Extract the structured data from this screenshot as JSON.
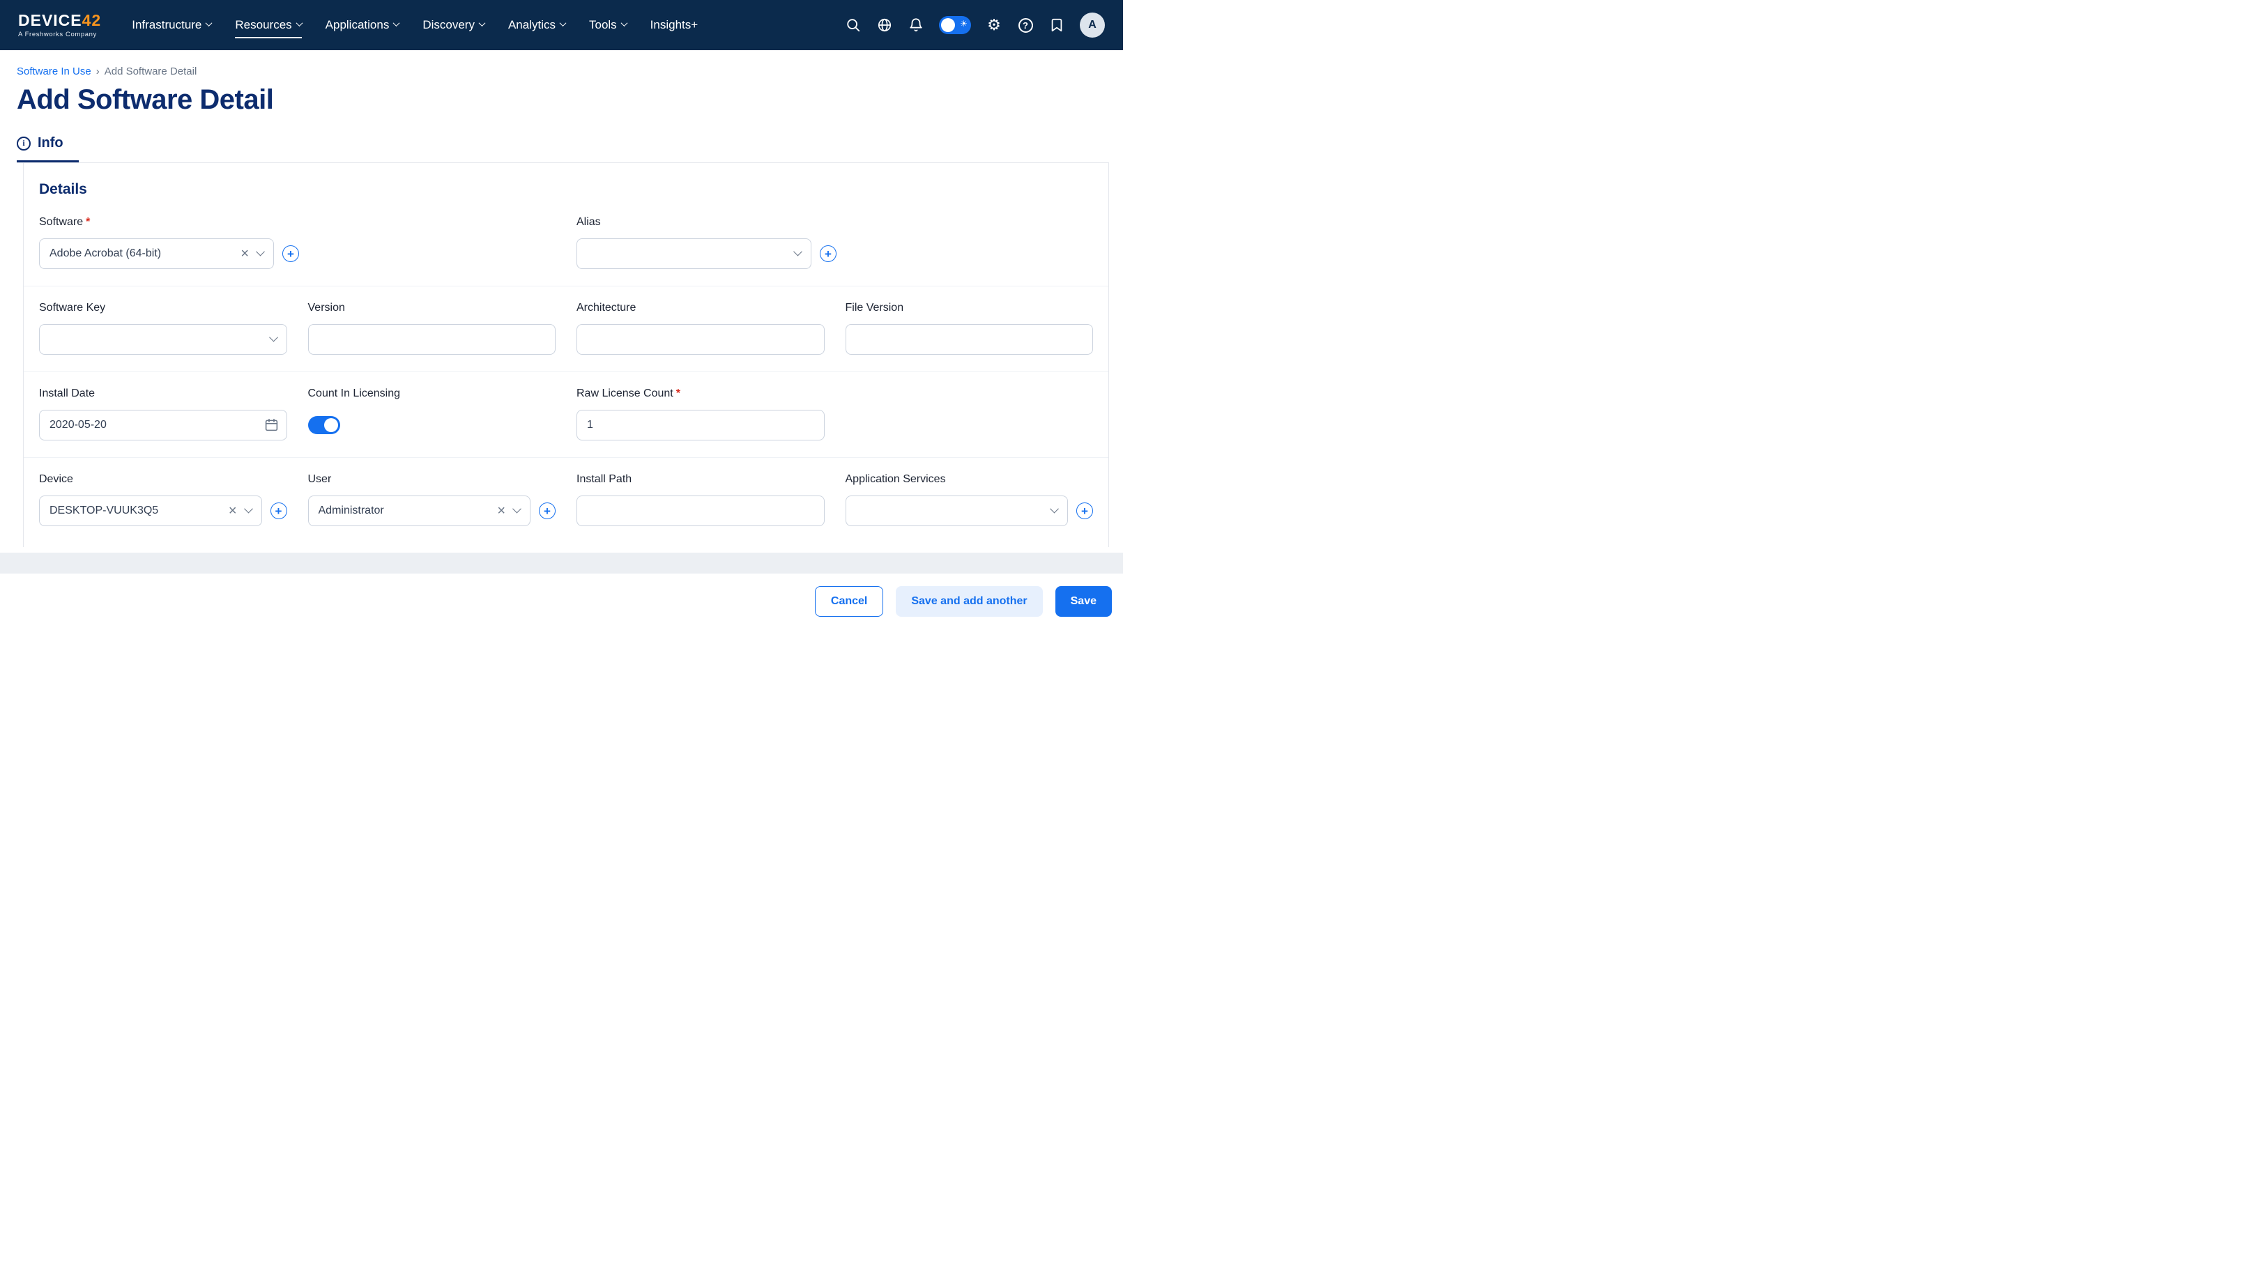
{
  "navbar": {
    "logo_text": "DEVICE",
    "logo_accent": "42",
    "tagline": "A Freshworks Company",
    "items": [
      {
        "label": "Infrastructure"
      },
      {
        "label": "Resources"
      },
      {
        "label": "Applications"
      },
      {
        "label": "Discovery"
      },
      {
        "label": "Analytics"
      },
      {
        "label": "Tools"
      },
      {
        "label": "Insights+"
      }
    ],
    "avatar_initial": "A"
  },
  "breadcrumb": {
    "parent": "Software In Use",
    "separator": "›",
    "current": "Add Software Detail"
  },
  "page_title": "Add Software Detail",
  "tabs": {
    "info": "Info"
  },
  "form": {
    "section_title": "Details",
    "required_marker": "*",
    "fields": {
      "software": {
        "label": "Software",
        "value": "Adobe Acrobat (64-bit)"
      },
      "alias": {
        "label": "Alias",
        "value": ""
      },
      "software_key": {
        "label": "Software Key",
        "value": ""
      },
      "version": {
        "label": "Version",
        "value": ""
      },
      "architecture": {
        "label": "Architecture",
        "value": ""
      },
      "file_version": {
        "label": "File Version",
        "value": ""
      },
      "install_date": {
        "label": "Install Date",
        "value": "2020-05-20"
      },
      "count_in_licensing": {
        "label": "Count In Licensing",
        "on": true
      },
      "raw_license_count": {
        "label": "Raw License Count",
        "value": "1"
      },
      "device": {
        "label": "Device",
        "value": "DESKTOP-VUUK3Q5"
      },
      "user": {
        "label": "User",
        "value": "Administrator"
      },
      "install_path": {
        "label": "Install Path",
        "value": ""
      },
      "application_services": {
        "label": "Application Services",
        "value": ""
      }
    }
  },
  "footer": {
    "cancel": "Cancel",
    "save_and_add": "Save and add another",
    "save": "Save"
  },
  "colors": {
    "header_bg": "#0B2A4C",
    "primary_blue": "#1570EF",
    "navy": "#0D2C6E",
    "accent_orange": "#F7941E",
    "required_red": "#D92D20"
  }
}
